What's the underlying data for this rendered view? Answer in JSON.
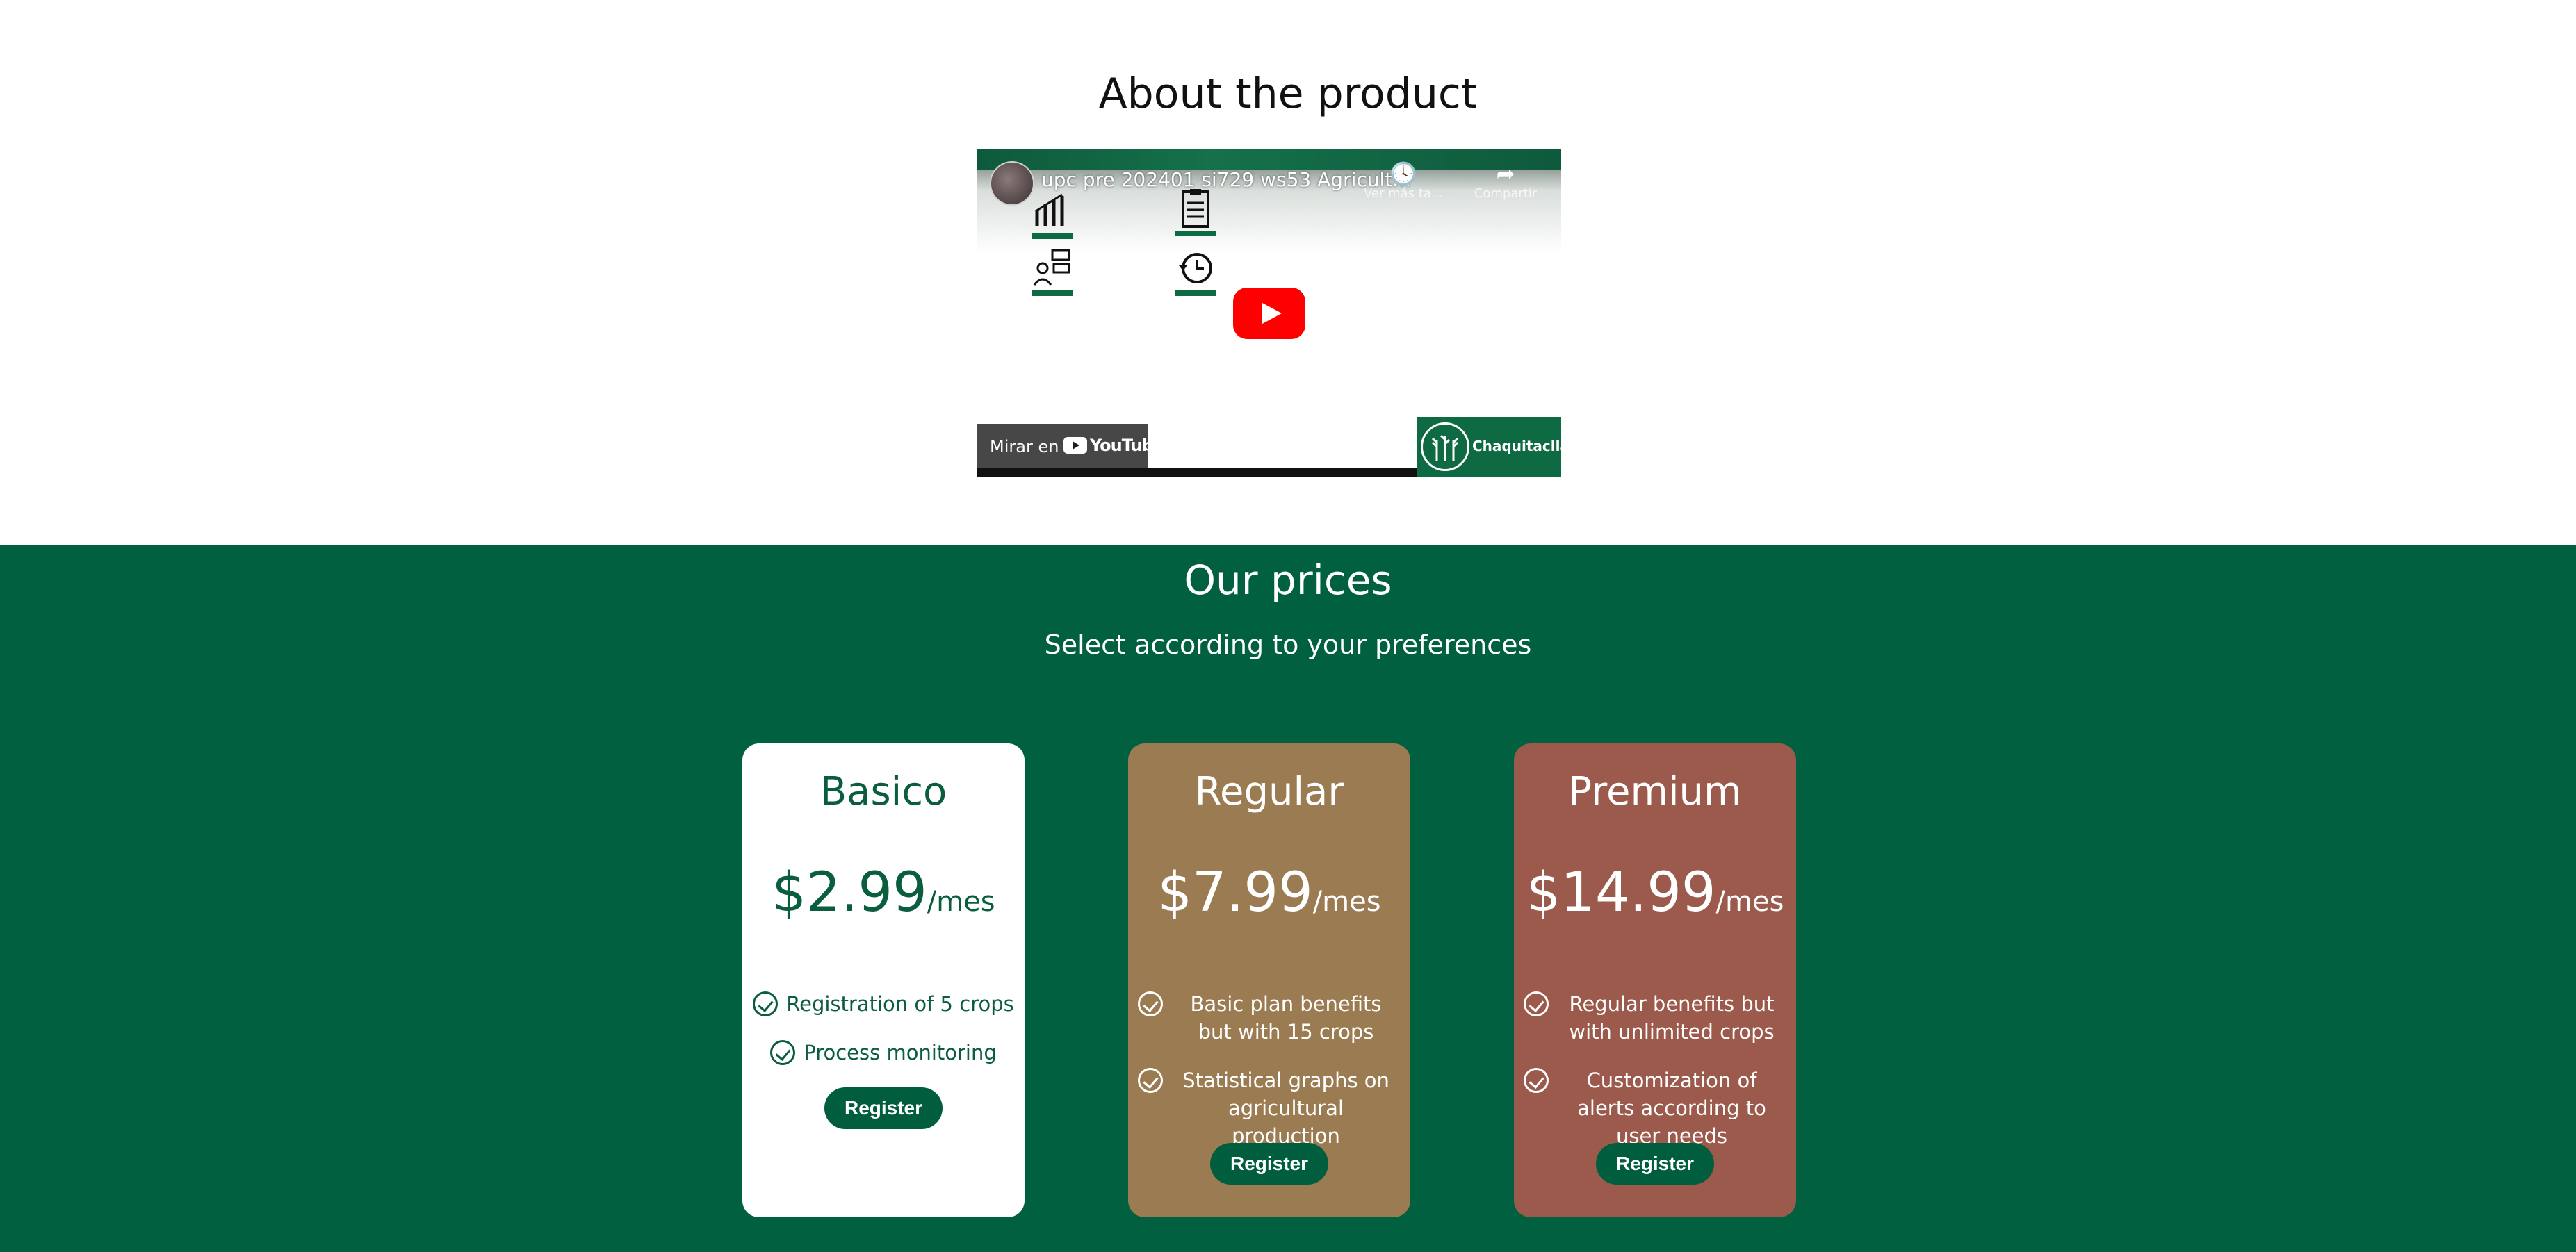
{
  "about": {
    "title": "About the product",
    "video": {
      "title": "upc pre 202401 si729 ws53 Agricult...",
      "watch_later_label": "Ver más ta...",
      "share_label": "Compartir",
      "watch_on_label": "Mirar en",
      "youtube_label": "YouTube",
      "brand_label": "Chaquitaclla"
    }
  },
  "prices": {
    "title": "Our prices",
    "subtitle": "Select according to your preferences",
    "plans": [
      {
        "name": "Basico",
        "price": "$2.99",
        "period": "/mes",
        "features": [
          "Registration of 5 crops",
          "Process monitoring"
        ],
        "button": "Register",
        "bg_color": "#ffffff",
        "text_color": "#0b5e3d"
      },
      {
        "name": "Regular",
        "price": "$7.99",
        "period": "/mes",
        "features": [
          "Basic plan benefits but with 15 crops",
          "Statistical graphs on agricultural production"
        ],
        "button": "Register",
        "bg_color": "#9b7b52",
        "text_color": "#ffffff"
      },
      {
        "name": "Premium",
        "price": "$14.99",
        "period": "/mes",
        "features": [
          "Regular benefits but with unlimited crops",
          "Customization of alerts according to user needs"
        ],
        "button": "Register",
        "bg_color": "#9b5a4b",
        "text_color": "#ffffff"
      }
    ]
  },
  "colors": {
    "brand_green": "#006040",
    "button_green": "#005e3e",
    "youtube_red": "#ff0000"
  }
}
